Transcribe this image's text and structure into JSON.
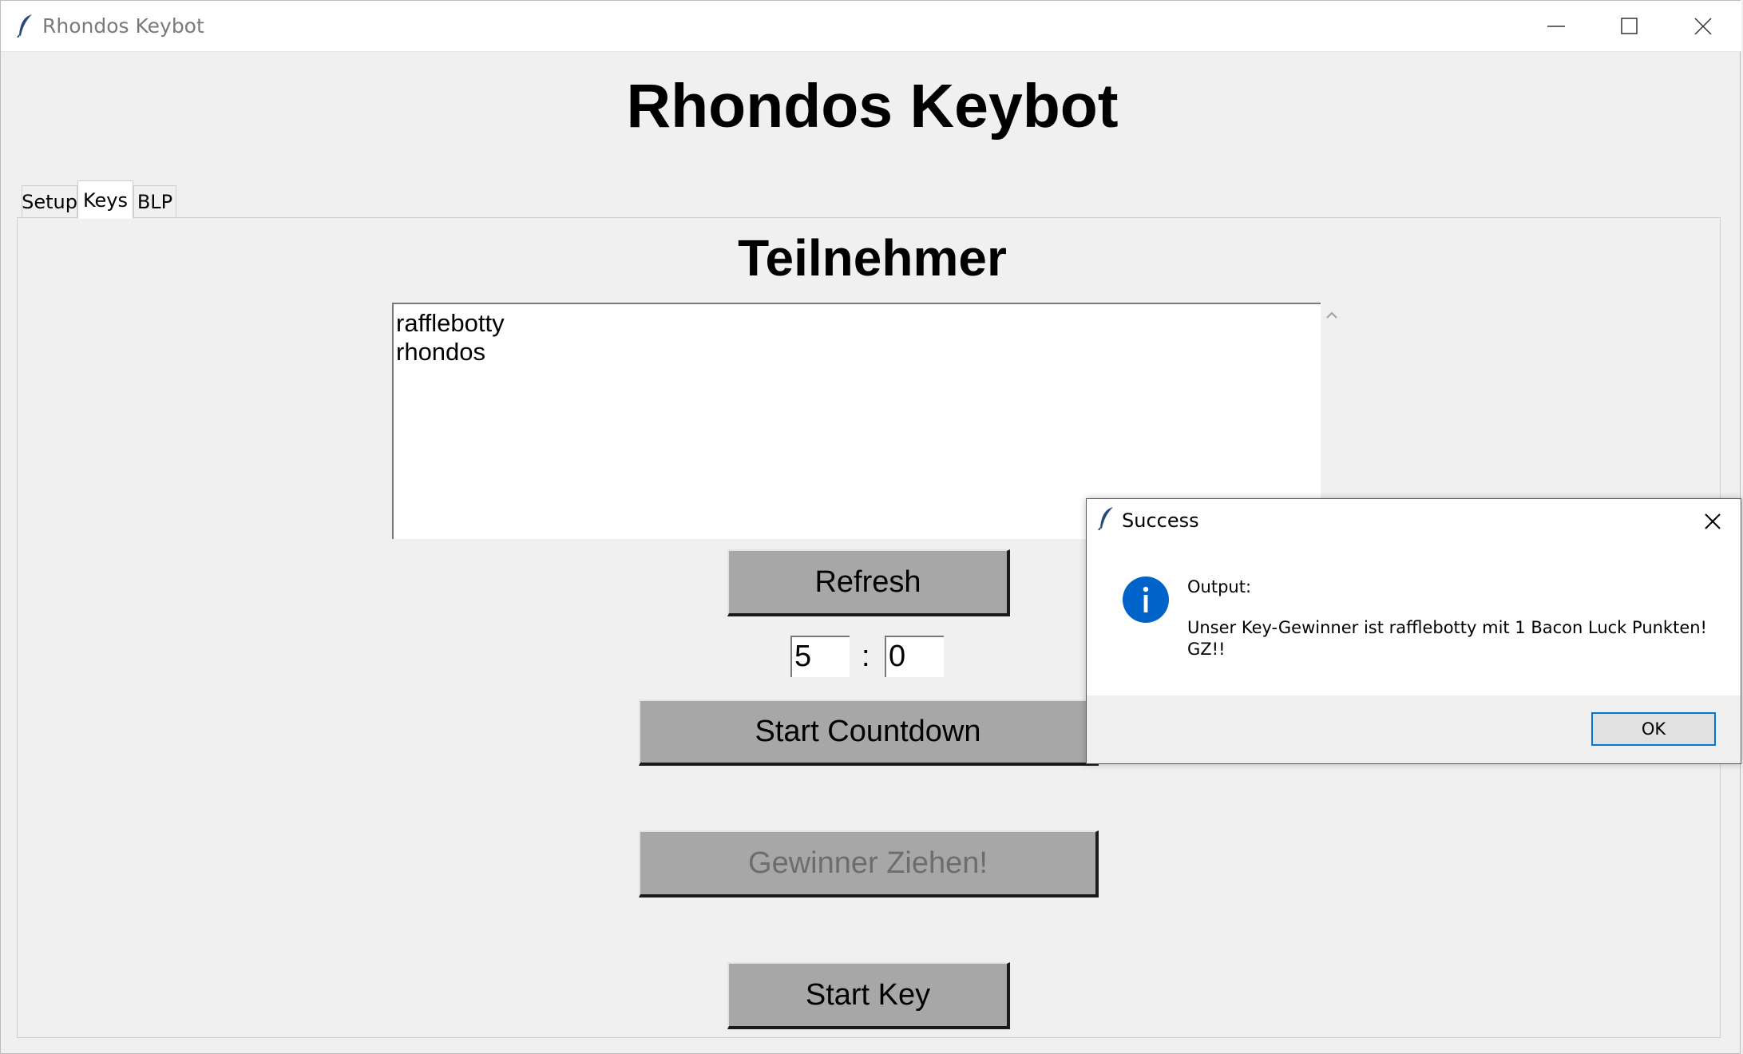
{
  "window": {
    "title": "Rhondos Keybot",
    "icon": "feather-icon"
  },
  "app": {
    "heading": "Rhondos Keybot"
  },
  "tabs": [
    {
      "label": "Setup",
      "active": false
    },
    {
      "label": "Keys",
      "active": true
    },
    {
      "label": "BLP",
      "active": false
    }
  ],
  "keys_tab": {
    "heading": "Teilnehmer",
    "participants": [
      "rafflebotty",
      "rhondos"
    ],
    "refresh_label": "Refresh",
    "minutes_value": "5",
    "time_separator": ":",
    "seconds_value": "0",
    "start_countdown_label": "Start Countdown",
    "draw_winner_label": "Gewinner Ziehen!",
    "start_key_label": "Start Key"
  },
  "dialog": {
    "title": "Success",
    "icon": "info-icon",
    "heading": "Output:",
    "message": "Unser Key-Gewinner ist rafflebotty mit 1 Bacon Luck Punkten! GZ!!",
    "ok_label": "OK"
  },
  "colors": {
    "button_bg": "#a7a7a7",
    "window_bg": "#f0f0f0",
    "dialog_info": "#0063c9",
    "focus_border": "#0078d7"
  }
}
